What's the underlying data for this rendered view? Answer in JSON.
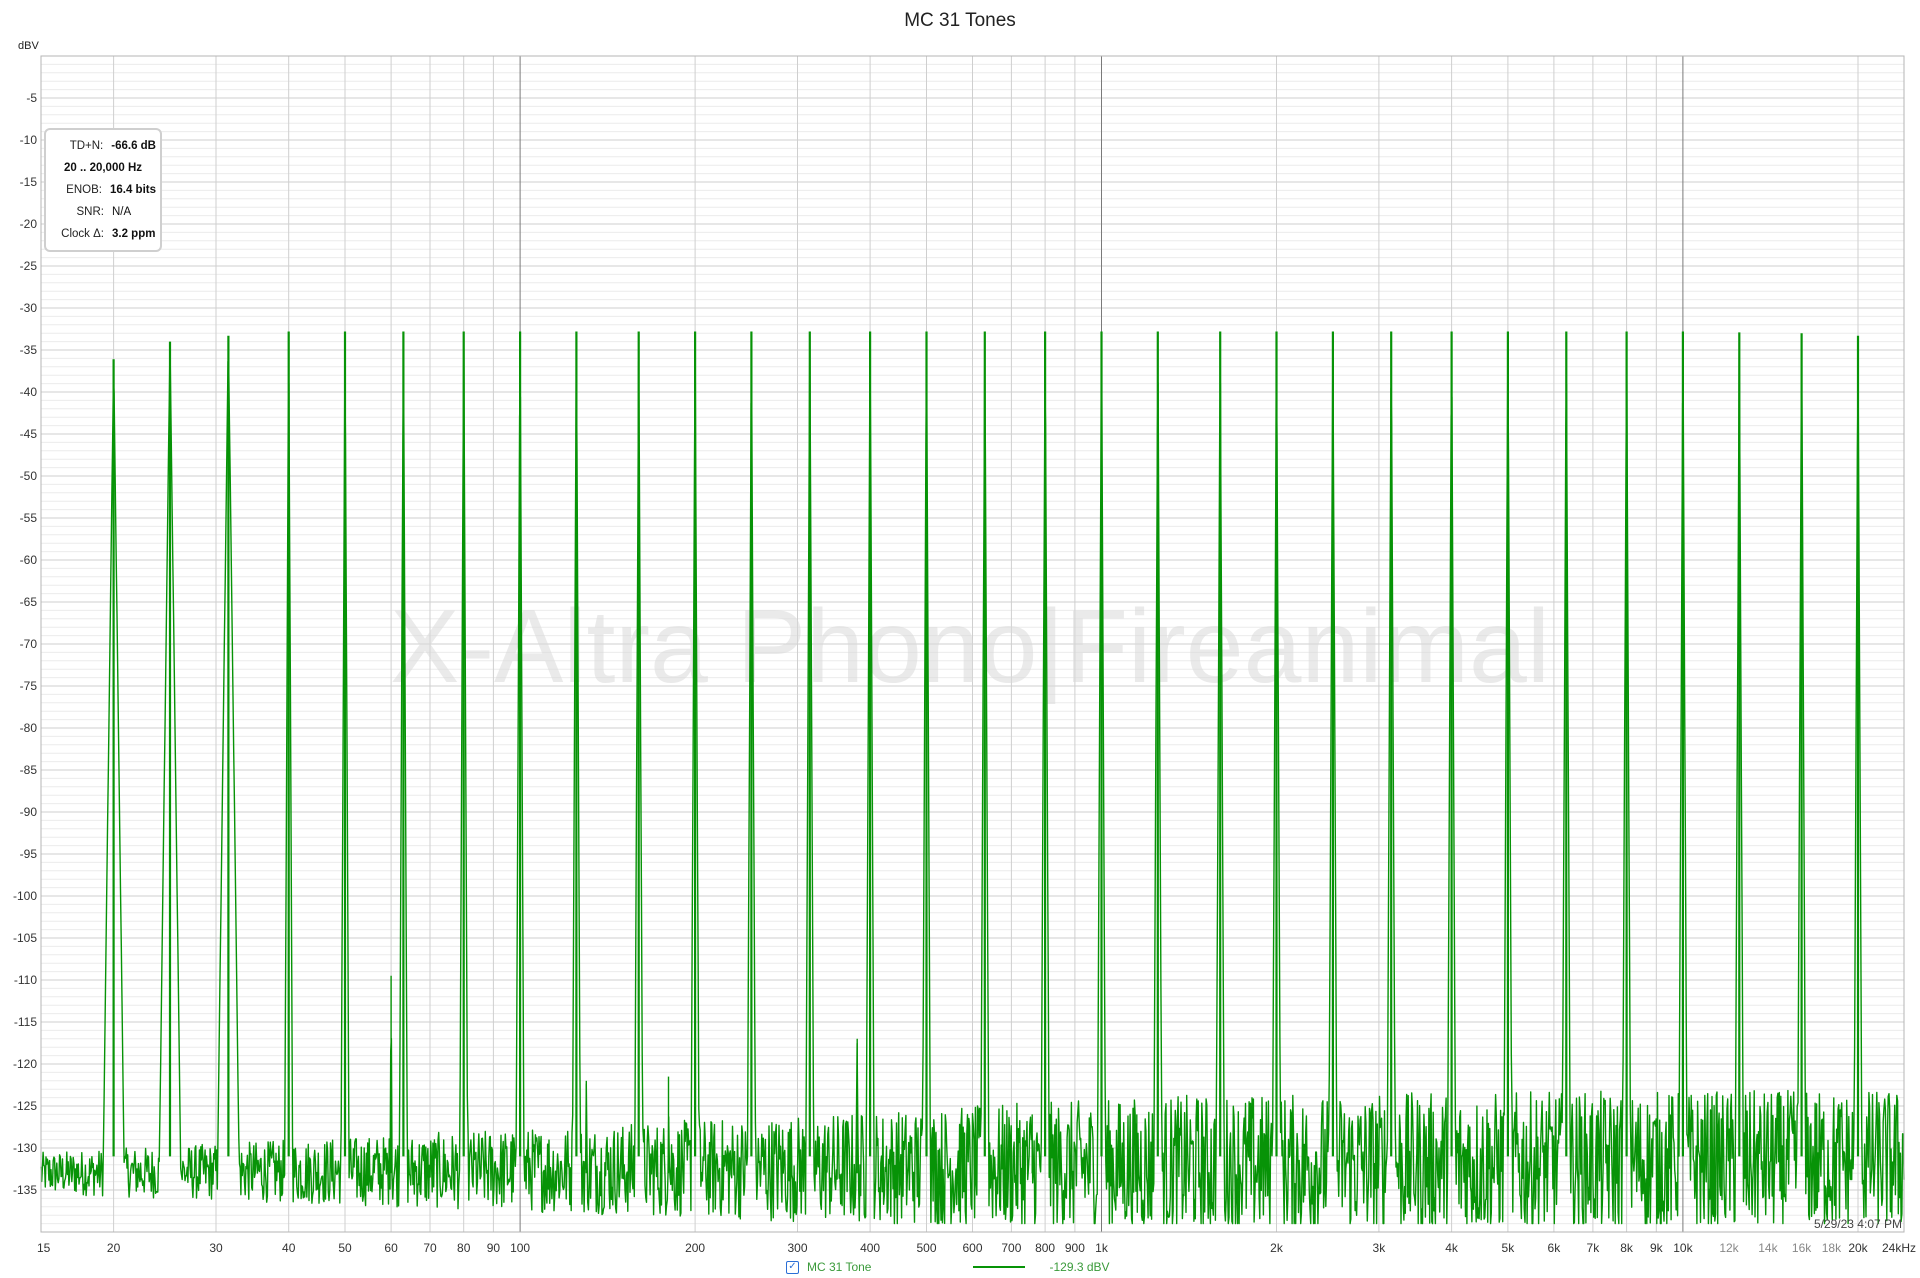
{
  "chart_data": {
    "type": "line",
    "title": "MC 31 Tones",
    "ylabel": "dBV",
    "xlabel": "",
    "x_scale": "log",
    "xlim": [
      15,
      24000
    ],
    "ylim": [
      -140,
      0
    ],
    "grid": true,
    "y_ticks": [
      -5,
      -10,
      -15,
      -20,
      -25,
      -30,
      -35,
      -40,
      -45,
      -50,
      -55,
      -60,
      -65,
      -70,
      -75,
      -80,
      -85,
      -90,
      -95,
      -100,
      -105,
      -110,
      -115,
      -120,
      -125,
      -130,
      -135
    ],
    "x_ticks": [
      {
        "value": 15,
        "label": "15"
      },
      {
        "value": 20,
        "label": "20"
      },
      {
        "value": 30,
        "label": "30"
      },
      {
        "value": 40,
        "label": "40"
      },
      {
        "value": 50,
        "label": "50"
      },
      {
        "value": 60,
        "label": "60"
      },
      {
        "value": 70,
        "label": "70"
      },
      {
        "value": 80,
        "label": "80"
      },
      {
        "value": 90,
        "label": "90"
      },
      {
        "value": 100,
        "label": "100"
      },
      {
        "value": 200,
        "label": "200"
      },
      {
        "value": 300,
        "label": "300"
      },
      {
        "value": 400,
        "label": "400"
      },
      {
        "value": 500,
        "label": "500"
      },
      {
        "value": 600,
        "label": "600"
      },
      {
        "value": 700,
        "label": "700"
      },
      {
        "value": 800,
        "label": "800"
      },
      {
        "value": 900,
        "label": "900"
      },
      {
        "value": 1000,
        "label": "1k"
      },
      {
        "value": 2000,
        "label": "2k"
      },
      {
        "value": 3000,
        "label": "3k"
      },
      {
        "value": 4000,
        "label": "4k"
      },
      {
        "value": 5000,
        "label": "5k"
      },
      {
        "value": 6000,
        "label": "6k"
      },
      {
        "value": 7000,
        "label": "7k"
      },
      {
        "value": 8000,
        "label": "8k"
      },
      {
        "value": 9000,
        "label": "9k"
      },
      {
        "value": 10000,
        "label": "10k"
      },
      {
        "value": 12000,
        "label": "12k"
      },
      {
        "value": 14000,
        "label": "14k"
      },
      {
        "value": 16000,
        "label": "16k"
      },
      {
        "value": 18000,
        "label": "18k"
      },
      {
        "value": 20000,
        "label": "20k"
      },
      {
        "value": 24000,
        "label": "24kHz"
      }
    ],
    "faint_x_labels": [
      "12k",
      "14k",
      "16k",
      "18k"
    ],
    "series": [
      {
        "name": "MC 31 Tone",
        "color": "#079307",
        "noise_floor_dbv": -133,
        "tones": [
          {
            "freq": 20,
            "level": -36.1
          },
          {
            "freq": 25,
            "level": -34.0
          },
          {
            "freq": 31.5,
            "level": -33.3
          },
          {
            "freq": 40,
            "level": -32.8
          },
          {
            "freq": 50,
            "level": -32.8
          },
          {
            "freq": 63,
            "level": -32.8
          },
          {
            "freq": 80,
            "level": -32.8
          },
          {
            "freq": 100,
            "level": -32.8
          },
          {
            "freq": 125,
            "level": -32.8
          },
          {
            "freq": 160,
            "level": -32.8
          },
          {
            "freq": 200,
            "level": -32.8
          },
          {
            "freq": 250,
            "level": -32.8
          },
          {
            "freq": 315,
            "level": -32.8
          },
          {
            "freq": 400,
            "level": -32.8
          },
          {
            "freq": 500,
            "level": -32.8
          },
          {
            "freq": 630,
            "level": -32.8
          },
          {
            "freq": 800,
            "level": -32.8
          },
          {
            "freq": 1000,
            "level": -32.8
          },
          {
            "freq": 1250,
            "level": -32.8
          },
          {
            "freq": 1600,
            "level": -32.8
          },
          {
            "freq": 2000,
            "level": -32.8
          },
          {
            "freq": 2500,
            "level": -32.8
          },
          {
            "freq": 3150,
            "level": -32.8
          },
          {
            "freq": 4000,
            "level": -32.8
          },
          {
            "freq": 5000,
            "level": -32.8
          },
          {
            "freq": 6300,
            "level": -32.8
          },
          {
            "freq": 8000,
            "level": -32.8
          },
          {
            "freq": 10000,
            "level": -32.8
          },
          {
            "freq": 12500,
            "level": -32.9
          },
          {
            "freq": 16000,
            "level": -33.0
          },
          {
            "freq": 20000,
            "level": -33.3
          }
        ],
        "spurs": [
          {
            "freq": 60,
            "level": -109.5
          },
          {
            "freq": 130,
            "level": -122
          },
          {
            "freq": 180,
            "level": -121.5
          },
          {
            "freq": 380,
            "level": -117
          },
          {
            "freq": 760,
            "level": -126
          },
          {
            "freq": 1150,
            "level": -126
          }
        ]
      }
    ],
    "legend": {
      "checked": true,
      "label": "MC 31 Tone",
      "readout": "-129.3 dBV"
    }
  },
  "stats_box": {
    "tdn_label": "TD+N:",
    "tdn_value": "-66.6 dB",
    "range": "20 .. 20,000 Hz",
    "enob_label": "ENOB:",
    "enob_value": "16.4 bits",
    "snr_label": "SNR:",
    "snr_value": "N/A",
    "clock_label": "Clock Δ:",
    "clock_value": "3.2 ppm"
  },
  "watermark": "X-Altra Phono|Fireanimal",
  "timestamp": "5/29/23 4:07 PM"
}
